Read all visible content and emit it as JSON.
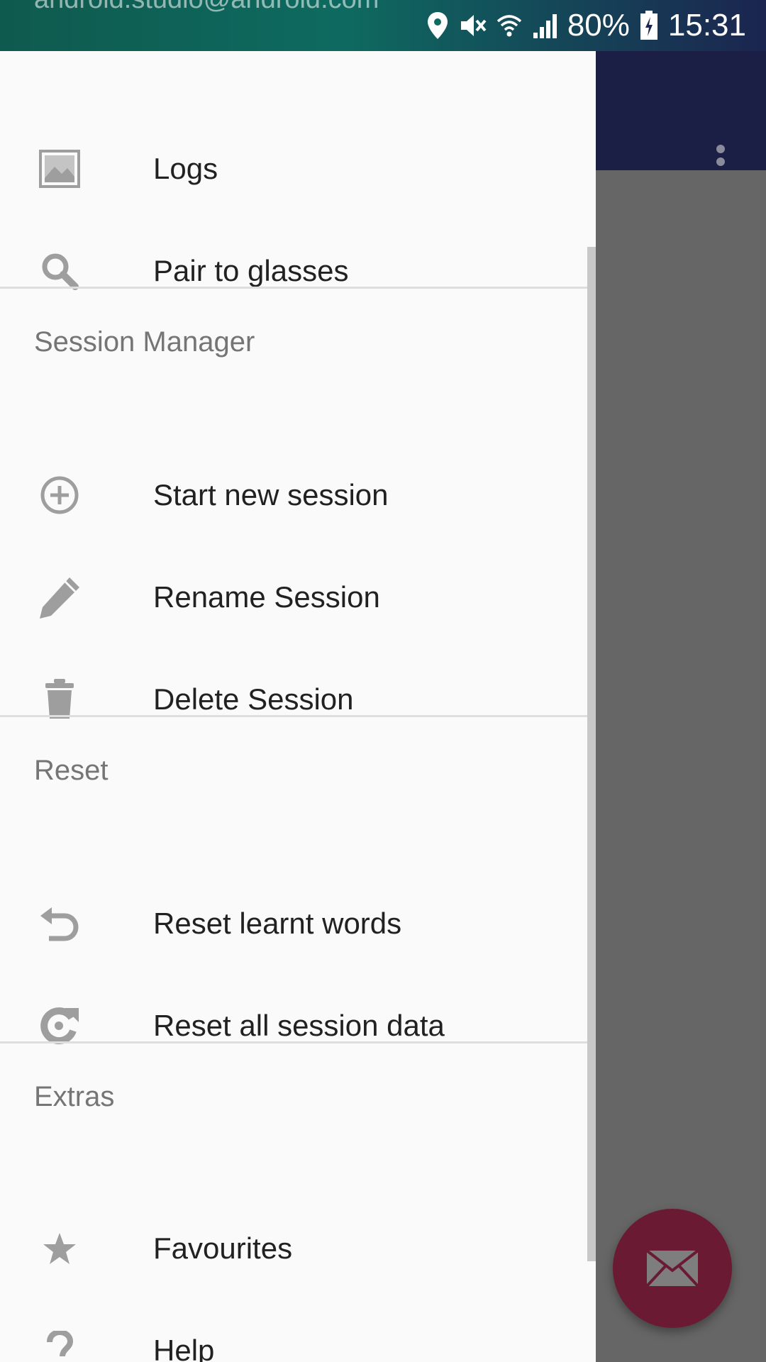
{
  "status_bar": {
    "account_email": "android.studio@android.com",
    "battery": "80%",
    "time": "15:31"
  },
  "drawer": {
    "top_items": [
      {
        "label": "Logs",
        "icon": "image-icon"
      },
      {
        "label": "Pair to glasses",
        "icon": "search-icon"
      }
    ],
    "session_manager": {
      "header": "Session Manager",
      "items": [
        {
          "label": "Start new session",
          "icon": "add-circle-icon"
        },
        {
          "label": "Rename Session",
          "icon": "pencil-icon"
        },
        {
          "label": "Delete Session",
          "icon": "trash-icon"
        }
      ]
    },
    "reset": {
      "header": "Reset",
      "items": [
        {
          "label": "Reset learnt words",
          "icon": "undo-icon"
        },
        {
          "label": "Reset all session data",
          "icon": "refresh-icon"
        }
      ]
    },
    "extras": {
      "header": "Extras",
      "items": [
        {
          "label": "Favourites",
          "icon": "star-icon"
        },
        {
          "label": "Help",
          "icon": "help-icon"
        }
      ]
    }
  },
  "colors": {
    "toolbar": "#1b1e45",
    "fab": "#6b1a34",
    "drawer_bg": "#fafafa",
    "scrim": "#666666"
  }
}
